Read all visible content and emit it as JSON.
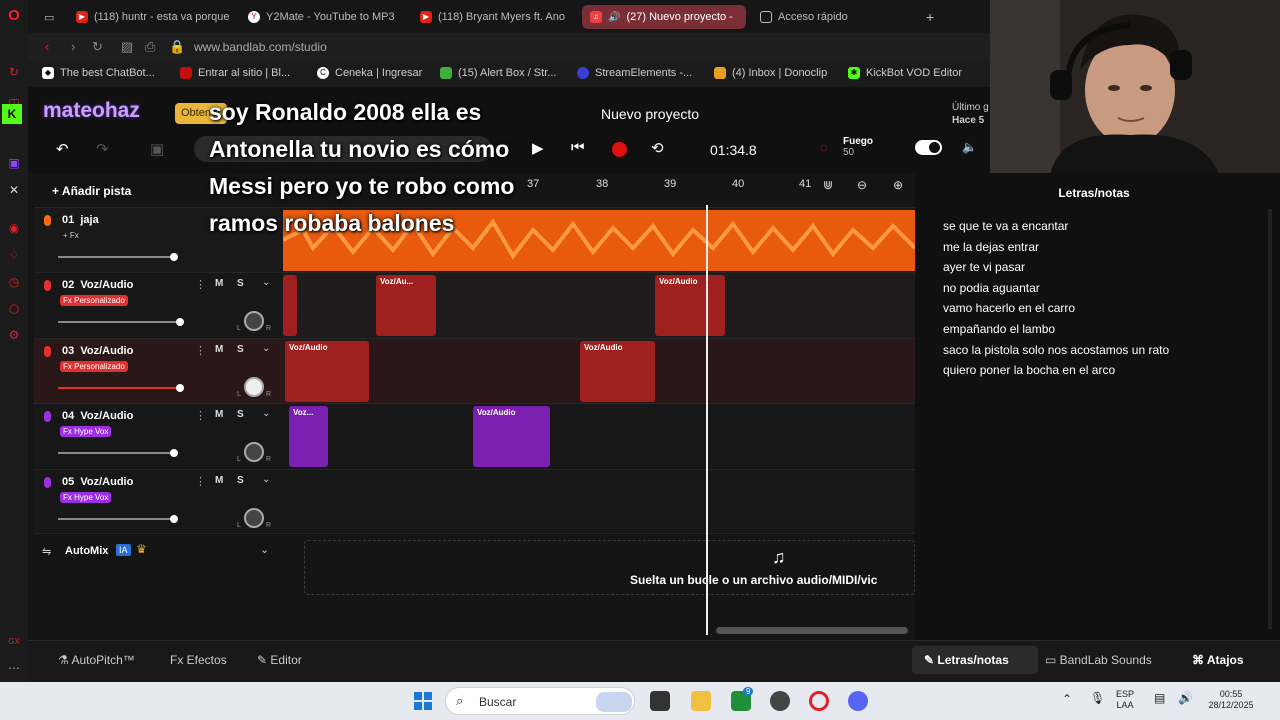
{
  "browser": {
    "tabs": [
      {
        "label": "(118) huntr - esta va porque",
        "active": false
      },
      {
        "label": "Y2Mate - YouTube to MP3",
        "active": false
      },
      {
        "label": "(118) Bryant Myers ft. Ano",
        "active": false
      },
      {
        "label": "(27) Nuevo proyecto -",
        "active": true
      },
      {
        "label": "Acceso rápido",
        "active": false
      }
    ],
    "url": "www.bandlab.com/studio",
    "bookmarks": [
      "The best ChatBot...",
      "Entrar al sitio | Bl...",
      "Ceneka | Ingresar",
      "(15) Alert Box / Str...",
      "StreamElements -...",
      "(4) Inbox | Donoclip",
      "KickBot VOD Editor"
    ]
  },
  "overlay": {
    "chat_user": "mateohaz",
    "chat_button": "Obtener",
    "lyric": "soy Ronaldo 2008 ella es Antonella tu novio es cómo Messi pero yo te robo como ramos robaba balones"
  },
  "studio": {
    "project_title": "Nuevo proyecto",
    "last_save_label": "Último g",
    "last_save_time": "Hace 5",
    "time": "01:34.8",
    "preset_name": "Fuego",
    "preset_value": "50",
    "add_track": "Añadir pista",
    "ruler": [
      "37",
      "38",
      "39",
      "40",
      "41"
    ],
    "tracks": [
      {
        "number": "01",
        "name": "jaja",
        "fx": "+ Fx",
        "color": "#ff6a10",
        "level": 0.9
      },
      {
        "number": "02",
        "name": "Voz/Audio",
        "fx": "Fx Personalizado",
        "color": "#e03030",
        "level": 0.95,
        "m": "M",
        "s": "S"
      },
      {
        "number": "03",
        "name": "Voz/Audio",
        "fx": "Fx Personalizado",
        "color": "#e03030",
        "level": 0.95,
        "m": "M",
        "s": "S"
      },
      {
        "number": "04",
        "name": "Voz/Audio",
        "fx": "Fx Hype Vox",
        "color": "#9b30e0",
        "level": 0.9,
        "m": "M",
        "s": "S"
      },
      {
        "number": "05",
        "name": "Voz/Audio",
        "fx": "Fx Hype Vox",
        "color": "#9b30e0",
        "level": 0.9,
        "m": "M",
        "s": "S"
      }
    ],
    "clips": {
      "t2": [
        "Voz/Au...",
        "Voz/Audio"
      ],
      "t3": [
        "Voz/Audio",
        "Voz/Audio"
      ],
      "t4": [
        "Voz...",
        "Voz/Audio"
      ]
    },
    "automix": "AutoMix",
    "automix_badge": "IA",
    "drop_text": "Suelta un bucle o un archivo audio/MIDI/vic",
    "panel_title": "Letras/notas",
    "lyrics": [
      "se que te va a encantar",
      "me la dejas  entrar",
      "ayer te vi pasar",
      "no podia aguantar",
      "vamo hacerlo en el carro",
      "empañando el lambo",
      "saco la pistola solo nos acostamos un rato",
      "quiero poner la bocha en el arco"
    ],
    "bottom": {
      "autopitch": "AutoPitch™",
      "effects": "Efectos",
      "editor": "Editor",
      "lyrics_tab": "Letras/notas",
      "sounds_tab": "BandLab Sounds",
      "shortcuts_tab": "Atajos"
    }
  },
  "taskbar": {
    "search": "Buscar",
    "lang1": "ESP",
    "lang2": "LAA",
    "time": "00:55",
    "date": "28/12/2025",
    "badge": "9"
  }
}
